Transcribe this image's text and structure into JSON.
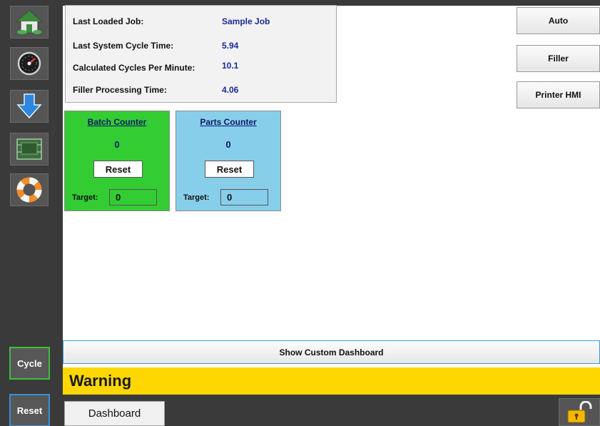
{
  "sidebar": {
    "icons": [
      "home-icon",
      "gauge-icon",
      "download-arrow-icon",
      "cpu-chip-icon",
      "lifebuoy-icon"
    ],
    "cycle_label": "Cycle",
    "reset_label": "Reset"
  },
  "info": {
    "last_loaded_job_label": "Last Loaded Job:",
    "last_loaded_job_value": "Sample Job",
    "last_cycle_time_label": "Last System Cycle Time:",
    "last_cycle_time_value": "5.94",
    "cycles_per_minute_label": "Calculated Cycles Per Minute:",
    "cycles_per_minute_value": "10.1",
    "filler_processing_label": "Filler Processing Time:",
    "filler_processing_value": "4.06"
  },
  "right_buttons": {
    "auto": "Auto",
    "filler": "Filler",
    "printer_hmi": "Printer HMI"
  },
  "batch_counter": {
    "title": "Batch Counter",
    "value": "0",
    "reset_label": "Reset",
    "target_label": "Target:",
    "target_value": "0"
  },
  "parts_counter": {
    "title": "Parts Counter",
    "value": "0",
    "reset_label": "Reset",
    "target_label": "Target:",
    "target_value": "0"
  },
  "show_custom_dashboard_label": "Show Custom Dashboard",
  "warning_text": "Warning",
  "bottom": {
    "dashboard_tab_label": "Dashboard",
    "lock_icon": "unlocked-padlock-icon"
  },
  "colors": {
    "batch_green": "#33cc33",
    "parts_blue": "#87ceeb",
    "warning_yellow": "#ffd700",
    "value_navy": "#1a2a9a",
    "sidebar_dark": "#3a3a3a"
  }
}
